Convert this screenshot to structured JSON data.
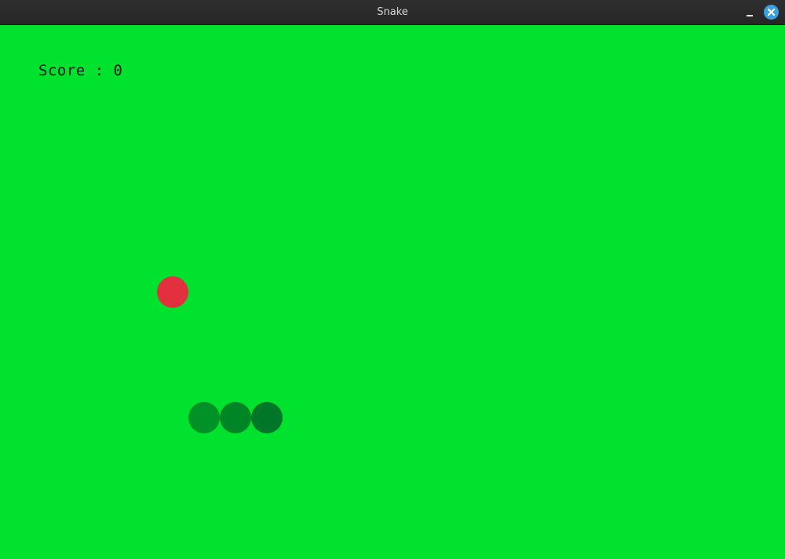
{
  "window": {
    "title": "Snake"
  },
  "hud": {
    "score_label": "Score : 0"
  },
  "game": {
    "food": {
      "color": "#e2303f"
    },
    "snake": {
      "segments": [
        {
          "color": "#009227"
        },
        {
          "color": "#008526"
        },
        {
          "color": "#007629"
        }
      ]
    },
    "background_color": "#00e22d"
  },
  "icons": {
    "minimize": "minimize-icon",
    "close": "close-icon"
  }
}
